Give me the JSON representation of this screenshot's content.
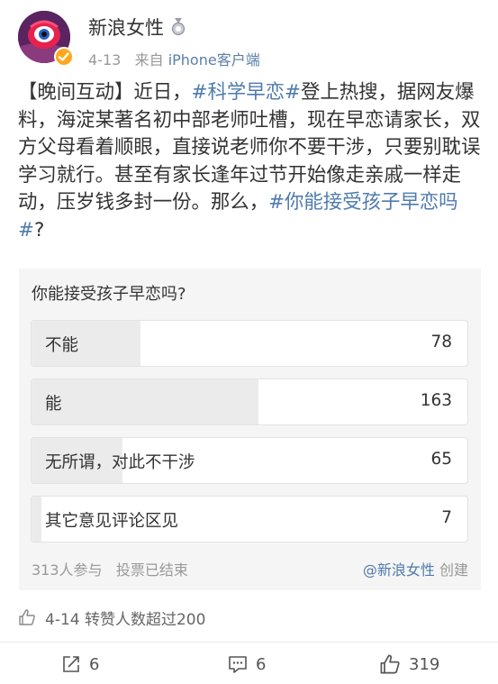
{
  "post": {
    "username": "新浪女性",
    "date": "4-13",
    "source_prefix": "来自",
    "source": "iPhone客户端",
    "text_1": "【晚间互动】近日，",
    "topic_1": "#科学早恋#",
    "text_2": "登上热搜，据网友爆料，海淀某著名初中部老师吐槽，现在早恋请家长，双方父母看着顺眼，直接说老师你不要干涉，只要别耽误学习就行。甚至有家长逢年过节开始像走亲戚一样走动，压岁钱多封一份。那么，",
    "topic_2": "#你能接受孩子早恋吗#",
    "text_3": "?"
  },
  "poll": {
    "question": "你能接受孩子早恋吗?",
    "options": [
      {
        "label": "不能",
        "count": "78"
      },
      {
        "label": "能",
        "count": "163"
      },
      {
        "label": "无所谓，对此不干涉",
        "count": "65"
      },
      {
        "label": "其它意见评论区见",
        "count": "7"
      }
    ],
    "participants": "313人参与",
    "status": "投票已结束",
    "creator": "@新浪女性",
    "created_label": "创建"
  },
  "repost_likes": "4-14 转赞人数超过200",
  "actions": {
    "repost_count": "6",
    "comment_count": "6",
    "like_count": "319"
  },
  "icons": {
    "avatar": "sina-eye-avatar",
    "verified": "verified-badge-icon",
    "medal": "medal-icon",
    "thumb": "thumb-up-icon",
    "repost": "repost-icon",
    "comment": "comment-icon"
  },
  "colors": {
    "link": "#4f7bae",
    "verified": "#ffa81c",
    "poll_bg": "#f5f5f5",
    "bar_fill": "#ebebeb"
  }
}
